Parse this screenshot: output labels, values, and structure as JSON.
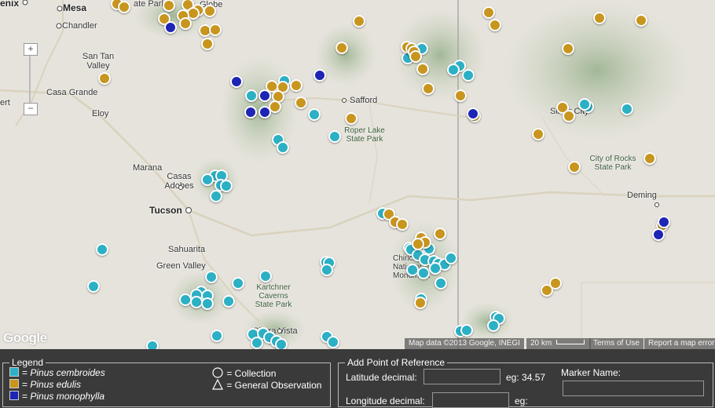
{
  "map": {
    "cities": [
      {
        "name": "enix",
        "big": true
      },
      {
        "name": "Mesa"
      },
      {
        "name": "Globe"
      },
      {
        "name": "Chandler"
      },
      {
        "name": "San Tan Valley"
      },
      {
        "name": "Casa Grande"
      },
      {
        "name": "Eloy"
      },
      {
        "name": "Marana"
      },
      {
        "name": "Casas Adobes"
      },
      {
        "name": "Tucson",
        "big": true
      },
      {
        "name": "Safford"
      },
      {
        "name": "Silver City"
      },
      {
        "name": "Deming"
      },
      {
        "name": "Sahuarita"
      },
      {
        "name": "Green Valley"
      },
      {
        "name": "Sierra Vista"
      },
      {
        "name": "Chiricahua National Monument"
      },
      {
        "name": "ert"
      },
      {
        "name": "ate Park"
      }
    ],
    "parks": [
      {
        "name": "Roper Lake State Park"
      },
      {
        "name": "City of Rocks State Park"
      },
      {
        "name": "Kartchner Caverns State Park"
      }
    ],
    "zoom": {
      "plus": "+",
      "minus": "−"
    },
    "google_logo": "Google",
    "attribution": {
      "map_data": "Map data ©2013 Google, INEGI",
      "scale": "20 km",
      "terms": "Terms of Use",
      "report": "Report a map error"
    },
    "colors": {
      "cembroides": "#2bb0c4",
      "edulis": "#c8961e",
      "monophylla": "#1d25b5"
    }
  },
  "legend": {
    "title": "Legend",
    "species": [
      {
        "prefix": "= ",
        "name": "Pinus cembroides",
        "color": "#2bb0c4"
      },
      {
        "prefix": "= ",
        "name": "Pinus edulis",
        "color": "#c8961e"
      },
      {
        "prefix": "= ",
        "name": "Pinus monophylla",
        "color": "#1d25b5"
      }
    ],
    "shapes": [
      {
        "label": "= Collection",
        "icon": "circle-icon"
      },
      {
        "label": "= General Observation",
        "icon": "triangle-icon"
      }
    ]
  },
  "add_point": {
    "title": "Add Point of Reference",
    "latitude_label": "Latitude decimal:",
    "latitude_value": "",
    "latitude_example": "eg: 34.57",
    "longitude_label": "Longitude decimal:",
    "longitude_value": "",
    "longitude_example": "eg:",
    "marker_name_label": "Marker Name:",
    "marker_name_value": ""
  }
}
